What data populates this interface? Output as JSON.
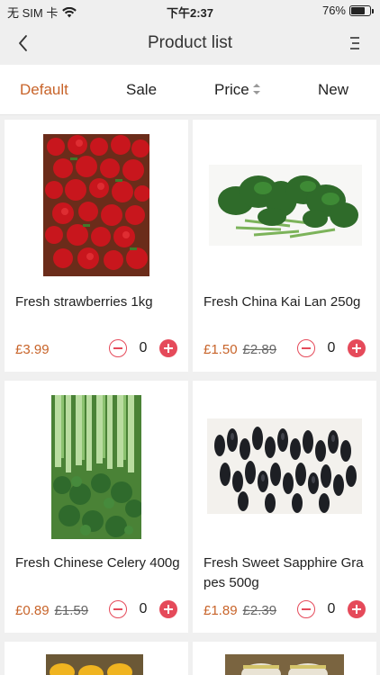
{
  "status_bar": {
    "carrier": "无 SIM 卡",
    "time": "下午2:37",
    "battery_text": "76%",
    "battery_level": 0.76
  },
  "nav": {
    "title": "Product list",
    "back_icon": "chevron-left-icon",
    "menu_icon": "list-menu-icon"
  },
  "sort_tabs": {
    "default": "Default",
    "sale": "Sale",
    "price": "Price",
    "new": "New",
    "active": "default",
    "active_color": "#c8642a"
  },
  "products": [
    {
      "name": "Fresh strawberries 1kg",
      "price": "£3.99",
      "old_price": "",
      "qty": "0",
      "image": "strawberries-image"
    },
    {
      "name": "Fresh China Kai Lan 250g",
      "price": "£1.50",
      "old_price": "£2.89",
      "qty": "0",
      "image": "kai-lan-image"
    },
    {
      "name": "Fresh Chinese Celery 400g",
      "price": "£0.89",
      "old_price": "£1.59",
      "qty": "0",
      "image": "celery-image"
    },
    {
      "name": "Fresh Sweet Sapphire Grapes 500g",
      "price": "£1.89",
      "old_price": "£2.39",
      "qty": "0",
      "image": "grapes-image"
    }
  ],
  "colors": {
    "accent": "#c8642a",
    "stepper": "#e54a5a"
  }
}
